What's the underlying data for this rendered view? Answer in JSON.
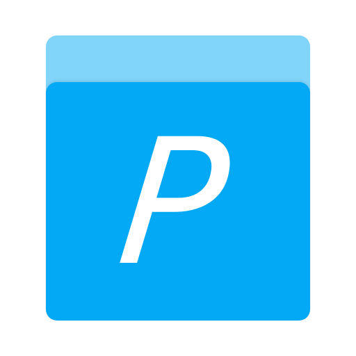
{
  "icon": {
    "name": "p-app-icon",
    "letter": "P",
    "colors": {
      "back_layer": "#81d4fa",
      "front_layer": "#03a9f4",
      "letter": "#ffffff",
      "background": "#ffffff"
    }
  }
}
